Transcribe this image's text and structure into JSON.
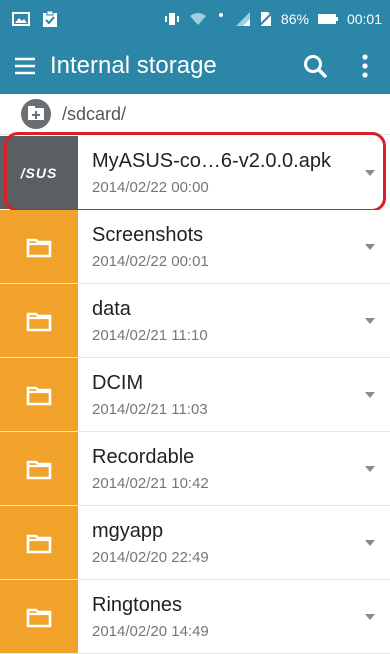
{
  "statusbar": {
    "battery_text": "86%",
    "time": "00:01",
    "icons": [
      "image-icon",
      "clipboard-check-icon",
      "vibrate-icon",
      "wifi-icon",
      "alarm-icon",
      "signal-icon",
      "no-sim-icon",
      "battery-icon"
    ]
  },
  "appbar": {
    "title": "Internal storage",
    "icons": [
      "hamburger-menu-icon",
      "search-icon",
      "overflow-menu-icon"
    ]
  },
  "path": {
    "text": "/sdcard/",
    "icon": "storage-folder-icon"
  },
  "colors": {
    "primary": "#2b86a8",
    "folder": "#f0a22a",
    "apk_thumb": "#5a5f63",
    "highlight": "#d6212b"
  },
  "files": [
    {
      "name": "MyASUS-co…6-v2.0.0.apk",
      "date": "2014/02/22 00:00",
      "type": "apk",
      "thumb_text": "/SUS"
    },
    {
      "name": "Screenshots",
      "date": "2014/02/22 00:01",
      "type": "folder"
    },
    {
      "name": "data",
      "date": "2014/02/21 11:10",
      "type": "folder"
    },
    {
      "name": "DCIM",
      "date": "2014/02/21 11:03",
      "type": "folder"
    },
    {
      "name": "Recordable",
      "date": "2014/02/21 10:42",
      "type": "folder"
    },
    {
      "name": "mgyapp",
      "date": "2014/02/20 22:49",
      "type": "folder"
    },
    {
      "name": "Ringtones",
      "date": "2014/02/20 14:49",
      "type": "folder"
    }
  ]
}
